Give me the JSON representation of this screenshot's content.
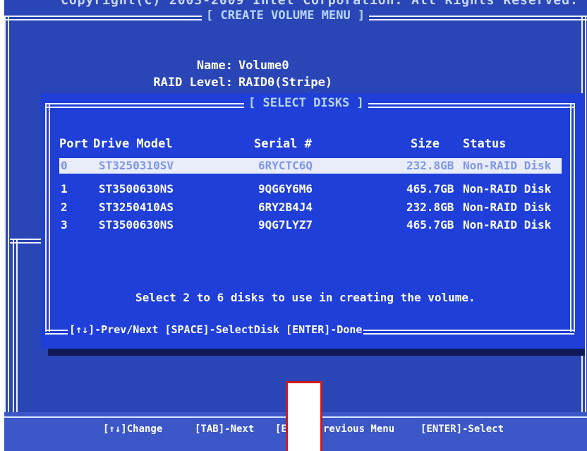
{
  "top": {
    "copyright_partial": "Copyright(C) 2003-2009 Intel Corporation. All Rights Reserved.",
    "menu_title": "[ CREATE VOLUME MENU ]"
  },
  "volume": {
    "name_label": "Name:",
    "name_value": "Volume0",
    "raid_label": "RAID Level:",
    "raid_value": "RAID0(Stripe)"
  },
  "disks_panel": {
    "title": "[ SELECT DISKS ]",
    "headers": {
      "port": "Port",
      "model": "Drive Model",
      "serial": "Serial #",
      "size": "Size",
      "status": "Status"
    },
    "rows": [
      {
        "port": "0",
        "model": "ST3250310SV",
        "serial": "6RYCTC6Q",
        "size": "232.8GB",
        "status": "Non-RAID Disk",
        "selected": true
      },
      {
        "port": "1",
        "model": "ST3500630NS",
        "serial": "9QG6Y6M6",
        "size": "465.7GB",
        "status": "Non-RAID Disk",
        "selected": false
      },
      {
        "port": "2",
        "model": "ST3250410AS",
        "serial": "6RY2B4J4",
        "size": "232.8GB",
        "status": "Non-RAID Disk",
        "selected": false
      },
      {
        "port": "3",
        "model": "ST3500630NS",
        "serial": "9QG7LYZ7",
        "size": "465.7GB",
        "status": "Non-RAID Disk",
        "selected": false
      }
    ],
    "instruction": "Select 2 to 6 disks to use in creating the volume.",
    "help_line": "[↑↓]-Prev/Next [SPACE]-SelectDisk [ENTER]-Done"
  },
  "footer": {
    "change": "[↑↓]Change",
    "tab": "[TAB]-Next",
    "esc_left": "[E",
    "esc_right": "revious Menu",
    "enter": "[ENTER]-Select"
  },
  "colors": {
    "bios_blue": "#2a45b6",
    "panel_blue": "#1f3fd8",
    "selected_row": "#e9edf9",
    "mask_border": "#d11a1a"
  }
}
